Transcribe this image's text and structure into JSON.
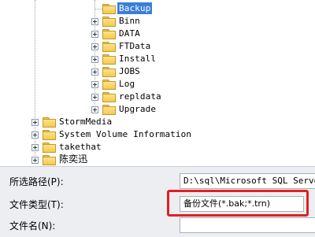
{
  "tree": {
    "children": [
      {
        "label": "Backup",
        "selected": true
      },
      {
        "label": "Binn"
      },
      {
        "label": "DATA"
      },
      {
        "label": "FTData"
      },
      {
        "label": "Install"
      },
      {
        "label": "JOBS"
      },
      {
        "label": "Log"
      },
      {
        "label": "repldata"
      },
      {
        "label": "Upgrade"
      }
    ],
    "roots": [
      {
        "label": "StormMedia"
      },
      {
        "label": "System Volume Information"
      },
      {
        "label": "takethat"
      },
      {
        "label": "陈奕迅"
      }
    ]
  },
  "form": {
    "path_label": "所选路径(P):",
    "path_value": "D:\\sql\\Microsoft SQL Server\\",
    "type_label": "文件类型(T):",
    "type_value": "备份文件(*.bak;*.trn)",
    "name_label": "文件名(N):",
    "name_value": ""
  },
  "colors": {
    "selection": "#3b7ed8",
    "highlight_box": "#e02020",
    "folder": "#f4c94f"
  },
  "icons": {
    "folder": "folder-icon",
    "expand": "plus-expander-icon",
    "dropdown": "chevron-down-icon"
  }
}
